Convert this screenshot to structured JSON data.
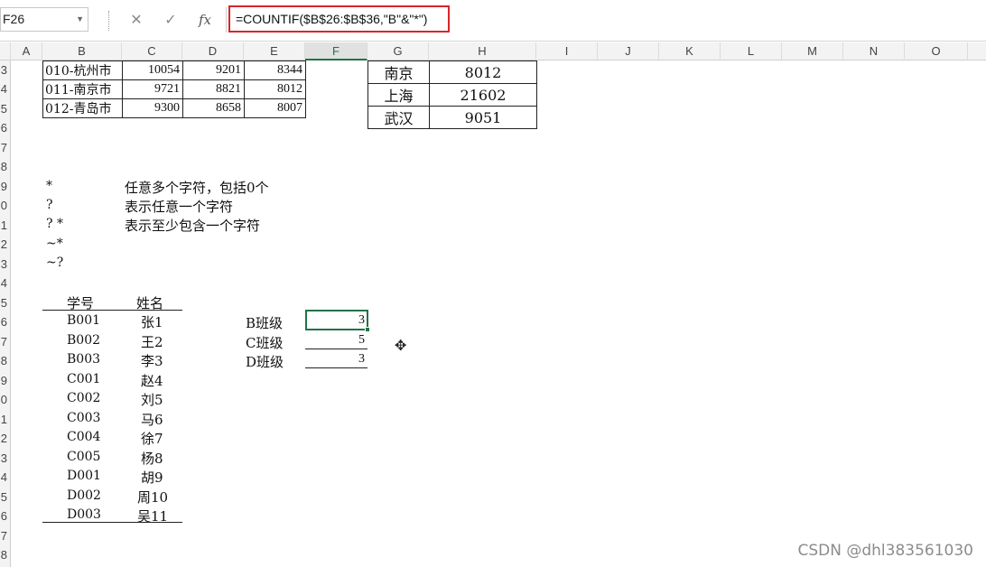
{
  "formula_bar": {
    "name_box": "F26",
    "cancel_icon": "✕",
    "confirm_icon": "✓",
    "fx_label": "fx",
    "formula": "=COUNTIF($B$26:$B$36,\"B\"&\"*\")"
  },
  "columns": [
    "A",
    "B",
    "C",
    "D",
    "E",
    "F",
    "G",
    "H",
    "I",
    "J",
    "K",
    "L",
    "M",
    "N",
    "O"
  ],
  "selected_column": "F",
  "rows": [
    "3",
    "4",
    "5",
    "6",
    "7",
    "8",
    "9",
    "0",
    "1",
    "2",
    "3",
    "4",
    "5",
    "6",
    "7",
    "8",
    "9",
    "0",
    "1",
    "2",
    "3",
    "4",
    "5",
    "6",
    "7",
    "8"
  ],
  "city_table": [
    {
      "name": "010-杭州市",
      "c": "10054",
      "d": "9201",
      "e": "8344"
    },
    {
      "name": "011-南京市",
      "c": "9721",
      "d": "8821",
      "e": "8012"
    },
    {
      "name": "012-青岛市",
      "c": "9300",
      "d": "8658",
      "e": "8007"
    }
  ],
  "lookup_table": [
    {
      "city": "南京",
      "value": "8012"
    },
    {
      "city": "上海",
      "value": "21602"
    },
    {
      "city": "武汉",
      "value": "9051"
    }
  ],
  "wildcards": [
    {
      "symbol": "*",
      "desc": "任意多个字符，包括0个"
    },
    {
      "symbol": "?",
      "desc": "表示任意一个字符"
    },
    {
      "symbol": "? *",
      "desc": "表示至少包含一个字符"
    },
    {
      "symbol": "~*",
      "desc": ""
    },
    {
      "symbol": "~?",
      "desc": ""
    }
  ],
  "students": {
    "headers": [
      "学号",
      "姓名"
    ],
    "rows": [
      [
        "B001",
        "张1"
      ],
      [
        "B002",
        "王2"
      ],
      [
        "B003",
        "李3"
      ],
      [
        "C001",
        "赵4"
      ],
      [
        "C002",
        "刘5"
      ],
      [
        "C003",
        "马6"
      ],
      [
        "C004",
        "徐7"
      ],
      [
        "C005",
        "杨8"
      ],
      [
        "D001",
        "胡9"
      ],
      [
        "D002",
        "周10"
      ],
      [
        "D003",
        "吴11"
      ]
    ]
  },
  "class_counts": [
    {
      "label": "B班级",
      "value": "3"
    },
    {
      "label": "C班级",
      "value": "5"
    },
    {
      "label": "D班级",
      "value": "3"
    }
  ],
  "watermark": "CSDN @dhl383561030"
}
